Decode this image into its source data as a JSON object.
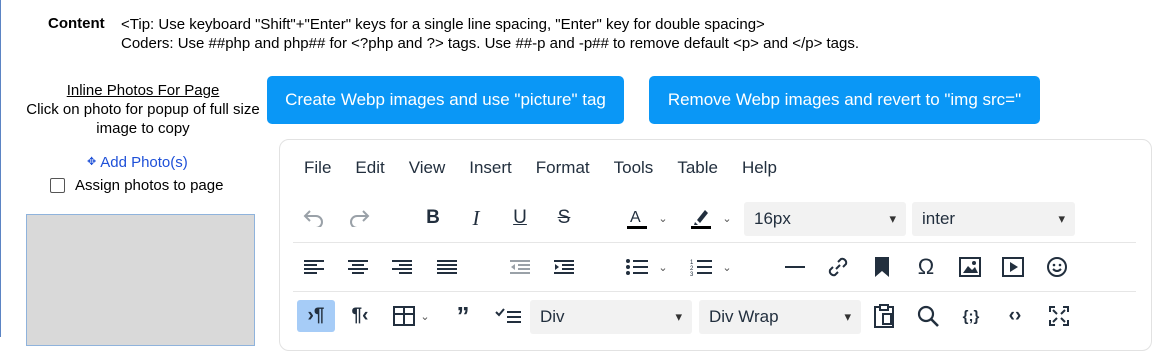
{
  "content_label": "Content",
  "tip_line1": "<Tip: Use keyboard \"Shift\"+\"Enter\" keys for a single line spacing, \"Enter\" key for double spacing>",
  "tip_line2": "Coders: Use ##php and php## for <?php and ?> tags. Use ##-p and -p## to remove default <p> and </p> tags.",
  "sidebar": {
    "title": "Inline Photos For Page",
    "desc": "Click on photo for popup of full size image to copy",
    "add_photo": "Add Photo(s)",
    "assign_label": "Assign photos to page"
  },
  "buttons": {
    "create_webp": "Create Webp images and use \"picture\" tag",
    "remove_webp": "Remove Webp images and revert to \"img src=\""
  },
  "menu": [
    "File",
    "Edit",
    "View",
    "Insert",
    "Format",
    "Tools",
    "Table",
    "Help"
  ],
  "toolbar": {
    "font_size": "16px",
    "font_family": "inter",
    "block_format": "Div",
    "wrap_format": "Div Wrap"
  },
  "icons": [
    "undo-icon",
    "redo-icon",
    "bold-icon",
    "italic-icon",
    "underline-icon",
    "strikethrough-icon",
    "text-color-icon",
    "highlight-icon",
    "align-left-icon",
    "align-center-icon",
    "align-right-icon",
    "justify-icon",
    "outdent-icon",
    "indent-icon",
    "bullet-list-icon",
    "numbered-list-icon",
    "horizontal-line-icon",
    "link-icon",
    "bookmark-icon",
    "omega-icon",
    "image-icon",
    "media-icon",
    "emoji-icon",
    "ltr-icon",
    "rtl-icon",
    "table-icon",
    "blockquote-icon",
    "list-check-icon",
    "paste-icon",
    "search-icon",
    "code-sample-icon",
    "source-code-icon",
    "fullscreen-icon"
  ],
  "colors": {
    "button_bg": "#0a97f6",
    "link": "#1e50d8",
    "active_tool": "#a6ccf7"
  }
}
